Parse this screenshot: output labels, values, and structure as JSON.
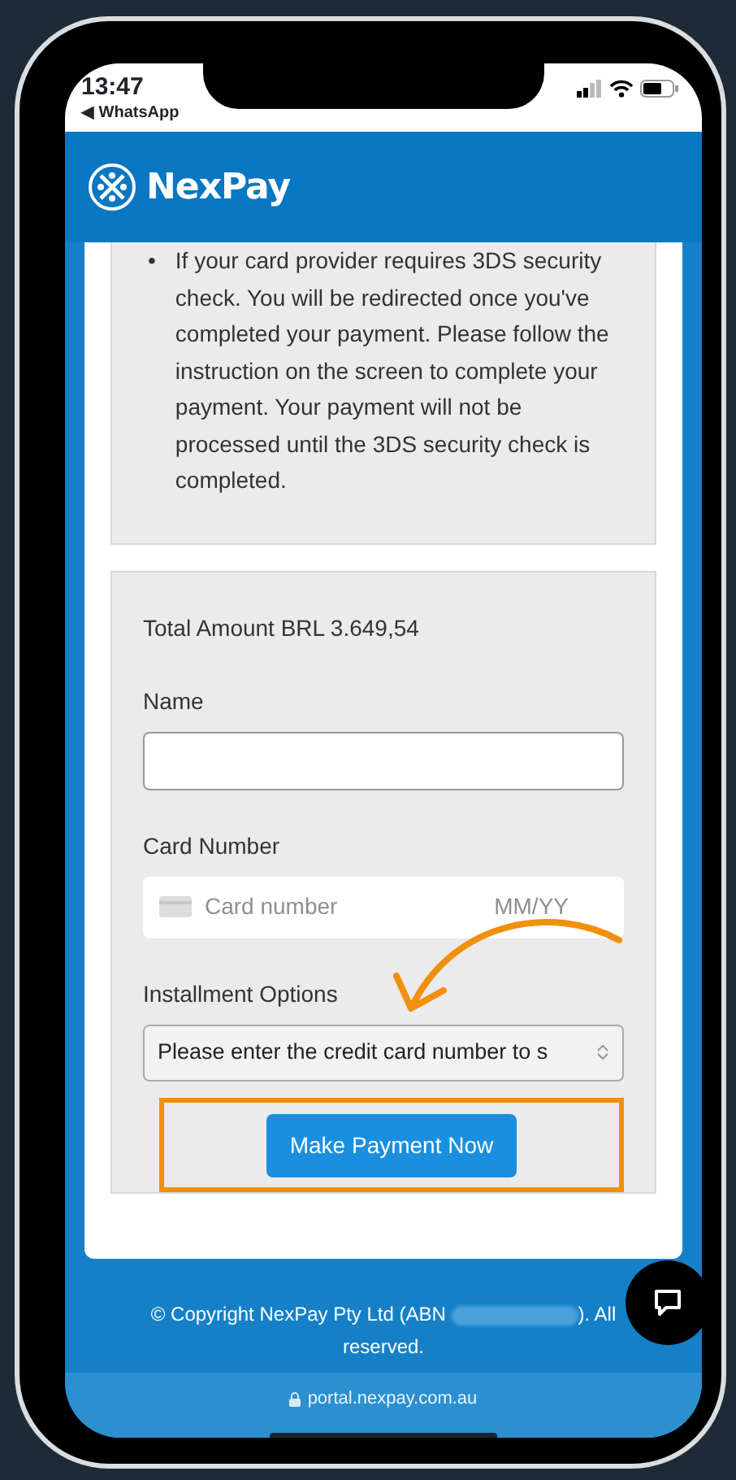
{
  "status_bar": {
    "time": "13:47",
    "back_app": "◀ WhatsApp"
  },
  "header": {
    "brand": "NexPay"
  },
  "notice": {
    "bullet_marker": "•",
    "bullets": [
      "If your card provider requires 3DS security check. You will be redirected once you've completed your payment. Please follow the instruction on the screen to complete your payment. Your payment will not be processed until the 3DS security check is completed."
    ]
  },
  "payment_form": {
    "total": "Total Amount BRL 3.649,54",
    "fields": [
      {
        "kind": "text",
        "label": "Name"
      },
      {
        "kind": "card",
        "label": "Card Number",
        "placeholder": "Card number",
        "expiry_placeholder": "MM/YY"
      },
      {
        "kind": "select",
        "label": "Installment Options",
        "value": "Please enter the credit card number to s"
      }
    ],
    "submit": "Make Payment Now"
  },
  "footer": {
    "copyright": "© Copyright NexPay Pty Ltd (ABN",
    "copyright_end": "). All",
    "copyright_line2": "reserved."
  },
  "browser_bar": {
    "url": "portal.nexpay.com.au"
  }
}
